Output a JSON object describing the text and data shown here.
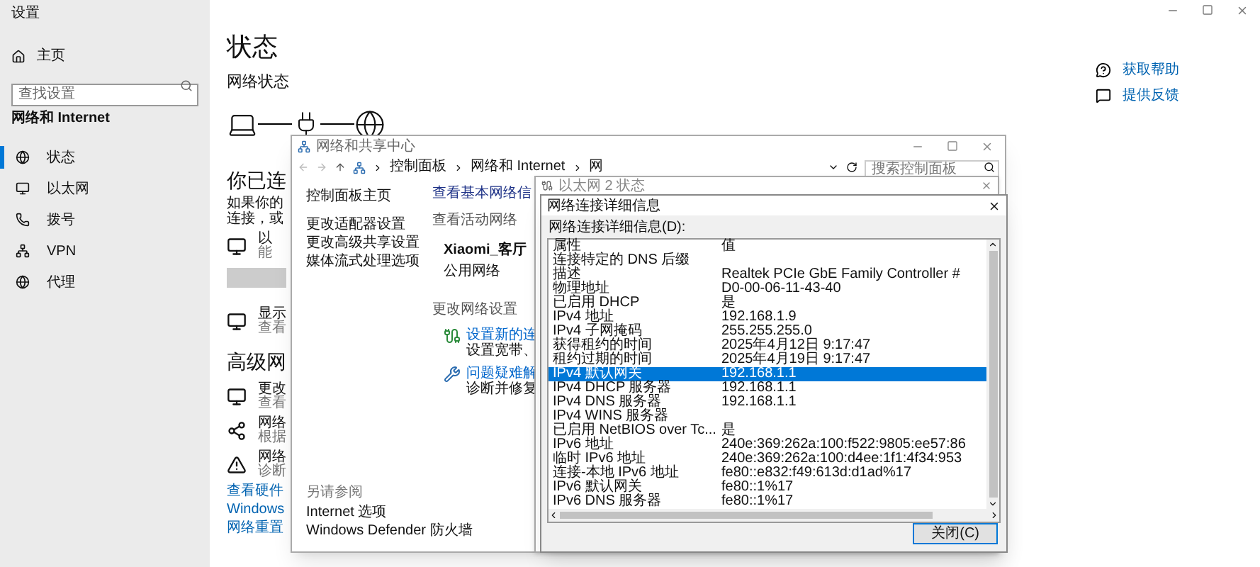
{
  "settings": {
    "title": "设置",
    "home": "主页",
    "search": {
      "placeholder": "查找设置"
    },
    "section": "网络和 Internet",
    "nav": [
      {
        "label": "状态",
        "selected": true
      },
      {
        "label": "以太网",
        "selected": false
      },
      {
        "label": "拨号",
        "selected": false
      },
      {
        "label": "VPN",
        "selected": false
      },
      {
        "label": "代理",
        "selected": false
      }
    ],
    "page_title": "状态",
    "subtitle": "网络状态",
    "connected_heading": "你已连",
    "description": [
      "如果你的",
      "连接，或"
    ],
    "ethernet_item": {
      "title": "以",
      "subtitle": "能"
    },
    "display_item": {
      "title": "显示",
      "subtitle": "查看"
    },
    "advanced_heading": "高级网",
    "advanced_items": [
      {
        "title": "更改",
        "subtitle": "查看"
      },
      {
        "title": "网络",
        "subtitle": "根据"
      },
      {
        "title": "网络",
        "subtitle": "诊断"
      }
    ],
    "links": [
      "查看硬件",
      "Windows",
      "网络重置"
    ],
    "help_links": [
      "获取帮助",
      "提供反馈"
    ]
  },
  "network_center": {
    "title": "网络和共享中心",
    "breadcrumb": [
      "控制面板",
      "网络和 Internet",
      "网"
    ],
    "search": {
      "placeholder": "搜索控制面板"
    },
    "left_links": [
      "控制面板主页",
      "更改适配器设置",
      "更改高级共享设置",
      "媒体流式处理选项"
    ],
    "see_also": {
      "heading": "另请参阅",
      "links": [
        "Internet 选项",
        "Windows Defender 防火墙"
      ]
    },
    "heading": "查看基本网络信",
    "active_heading": "查看活动网络",
    "network_name": "Xiaomi_客厅",
    "network_type": "公用网络",
    "change_heading": "更改网络设置",
    "tasks": [
      {
        "title": "设置新的连",
        "desc": "设置宽带、"
      },
      {
        "title": "问题疑难解",
        "desc": "诊断并修复"
      }
    ]
  },
  "status_window": {
    "title": "以太网 2 状态"
  },
  "details_dialog": {
    "title": "网络连接详细信息",
    "label": "网络连接详细信息(D):",
    "columns": [
      "属性",
      "值"
    ],
    "rows": [
      {
        "property": "连接特定的 DNS 后缀",
        "value": "",
        "selected": false
      },
      {
        "property": "描述",
        "value": "Realtek PCIe GbE Family Controller #",
        "selected": false
      },
      {
        "property": "物理地址",
        "value": "D0-00-06-11-43-40",
        "selected": false
      },
      {
        "property": "已启用 DHCP",
        "value": "是",
        "selected": false
      },
      {
        "property": "IPv4 地址",
        "value": "192.168.1.9",
        "selected": false
      },
      {
        "property": "IPv4 子网掩码",
        "value": "255.255.255.0",
        "selected": false
      },
      {
        "property": "获得租约的时间",
        "value": "2025年4月12日 9:17:47",
        "selected": false
      },
      {
        "property": "租约过期的时间",
        "value": "2025年4月19日 9:17:47",
        "selected": false
      },
      {
        "property": "IPv4 默认网关",
        "value": "192.168.1.1",
        "selected": true
      },
      {
        "property": "IPv4 DHCP 服务器",
        "value": "192.168.1.1",
        "selected": false
      },
      {
        "property": "IPv4 DNS 服务器",
        "value": "192.168.1.1",
        "selected": false
      },
      {
        "property": "IPv4 WINS 服务器",
        "value": "",
        "selected": false
      },
      {
        "property": "已启用 NetBIOS over Tc...",
        "value": "是",
        "selected": false
      },
      {
        "property": "IPv6 地址",
        "value": "240e:369:262a:100:f522:9805:ee57:86",
        "selected": false
      },
      {
        "property": "临时 IPv6 地址",
        "value": "240e:369:262a:100:d4ee:1f1:4f34:953",
        "selected": false
      },
      {
        "property": "连接-本地 IPv6 地址",
        "value": "fe80::e832:f49:613d:d1ad%17",
        "selected": false
      },
      {
        "property": "IPv6 默认网关",
        "value": "fe80::1%17",
        "selected": false
      },
      {
        "property": "IPv6 DNS 服务器",
        "value": "fe80::1%17",
        "selected": false
      }
    ],
    "close_button": "关闭(C)"
  }
}
